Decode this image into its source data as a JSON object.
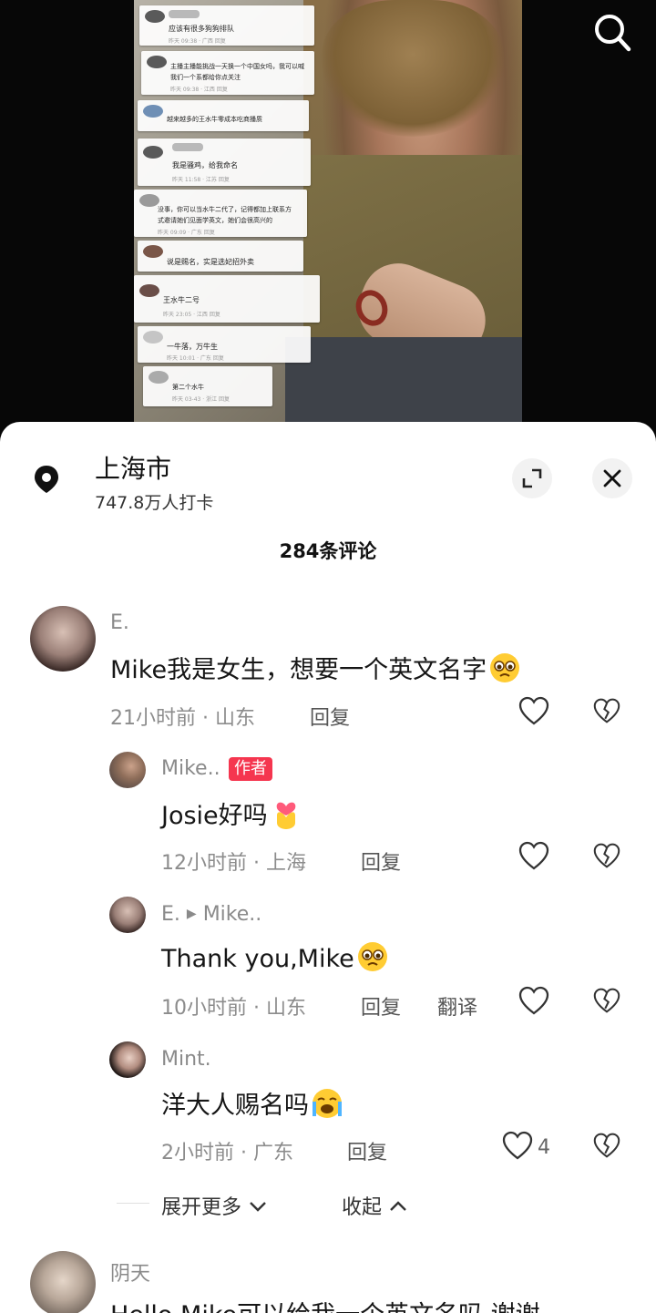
{
  "video": {
    "overlay_comments": [
      {
        "text": "应该有很多狗狗排队",
        "meta": "昨天 09:38 · 广西    回复"
      },
      {
        "text": "主播主播能挑战一天换一个中国女吗，我可以喊",
        "text2": "我们一个系都给你点关注",
        "meta": "昨天 09:38 · 江西    回复"
      },
      {
        "text": "越来越多的王水牛零成本吃商播质",
        "meta": ""
      },
      {
        "text": "我是骚鸡，给我命名",
        "meta": "昨天 11:58 · 江苏    回复"
      },
      {
        "text": "没事，你可以当水牛二代了，记得都加上联系方",
        "text2": "式邀请她们见面学英文，她们会很高兴的",
        "meta": "昨天 09:09 · 广东    回复"
      },
      {
        "text": "说是赐名，实是选妃招外卖",
        "meta": ""
      },
      {
        "text": "王水牛二号",
        "meta": "昨天 23:05 · 江西    回复"
      },
      {
        "text": "一牛落，万牛生",
        "meta": "昨天 10:01 · 广东    回复"
      },
      {
        "text": "第二个水牛",
        "meta": "昨天 03-43 · 浙江    回复"
      }
    ]
  },
  "location": {
    "name": "上海市",
    "checkins": "747.8万人打卡"
  },
  "comments_header": {
    "count_label": "284条评论"
  },
  "comments": [
    {
      "user": "E.",
      "text": "Mike我是女生，想要一个英文名字",
      "time": "21小时前",
      "region": "山东",
      "reply_label": "回复"
    }
  ],
  "replies": [
    {
      "user": "Mike..",
      "badge": "作者",
      "text": "Josie好吗",
      "time": "12小时前",
      "region": "上海",
      "reply_label": "回复"
    },
    {
      "user": "E.",
      "reply_to": "Mike..",
      "text": "Thank you,Mike",
      "time": "10小时前",
      "region": "山东",
      "reply_label": "回复",
      "translate_label": "翻译"
    },
    {
      "user": "Mint.",
      "text": "洋大人赐名吗",
      "time": "2小时前",
      "region": "广东",
      "reply_label": "回复",
      "likes": "4"
    }
  ],
  "thread_controls": {
    "expand_more": "展开更多",
    "collapse": "收起"
  },
  "next_comment": {
    "user": "阴天",
    "text": "Hello Mike可以给我一个英文名吗 谢谢"
  },
  "meta_separator": "·",
  "colors": {
    "author_badge": "#f5364f",
    "sheet_bg": "#ffffff"
  }
}
